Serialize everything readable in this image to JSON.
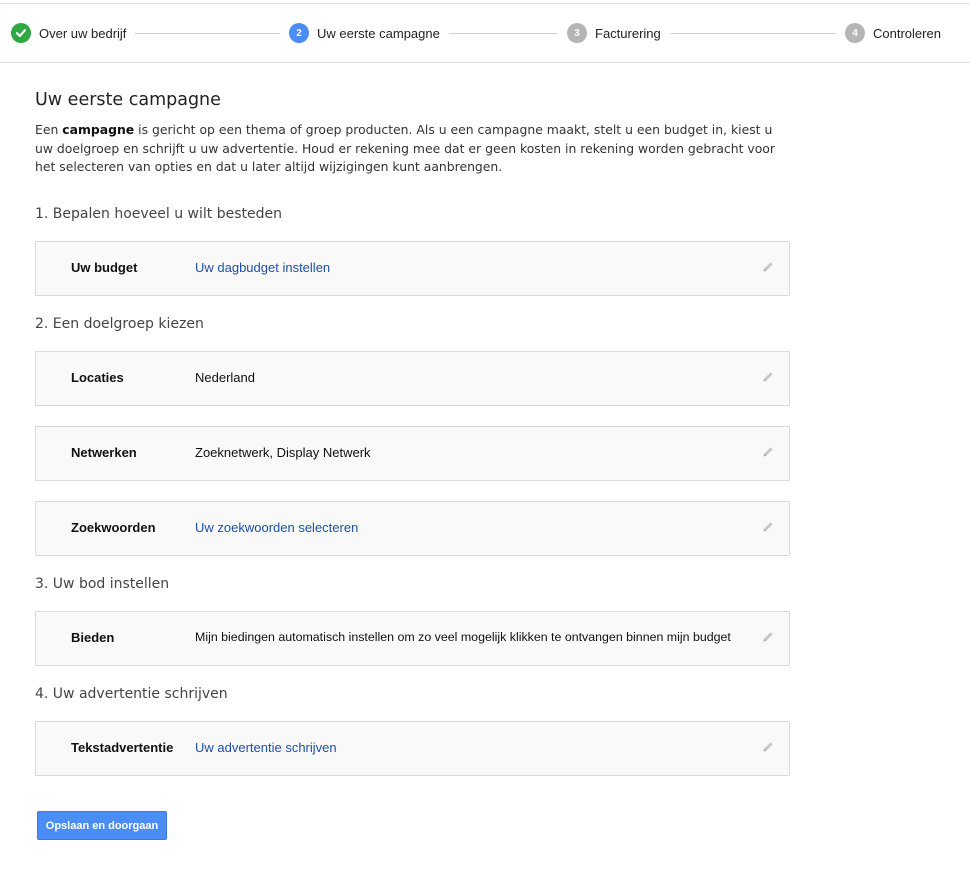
{
  "stepper": {
    "steps": [
      {
        "number": "",
        "label": "Over uw bedrijf",
        "state": "done"
      },
      {
        "number": "2",
        "label": "Uw eerste campagne",
        "state": "active"
      },
      {
        "number": "3",
        "label": "Facturering",
        "state": "pending"
      },
      {
        "number": "4",
        "label": "Controleren",
        "state": "pending"
      }
    ]
  },
  "page": {
    "title": "Uw eerste campagne",
    "intro_prefix": "Een ",
    "intro_bold": "campagne",
    "intro_rest": " is gericht op een thema of groep producten. Als u een campagne maakt, stelt u een budget in, kiest u uw doelgroep en schrijft u uw advertentie. Houd er rekening mee dat er geen kosten in rekening worden gebracht voor het selecteren van opties en dat u later altijd wijzigingen kunt aanbrengen."
  },
  "sections": [
    {
      "heading": "1. Bepalen hoeveel u wilt besteden"
    },
    {
      "heading": "2. Een doelgroep kiezen"
    },
    {
      "heading": "3. Uw bod instellen"
    },
    {
      "heading": "4. Uw advertentie schrijven"
    }
  ],
  "cards": {
    "budget": {
      "label": "Uw budget",
      "value": "Uw dagbudget instellen"
    },
    "locations": {
      "label": "Locaties",
      "value": "Nederland"
    },
    "networks": {
      "label": "Netwerken",
      "value": "Zoeknetwerk, Display Netwerk"
    },
    "keywords": {
      "label": "Zoekwoorden",
      "value": "Uw zoekwoorden selecteren"
    },
    "bidding": {
      "label": "Bieden",
      "value": "Mijn biedingen automatisch instellen om zo veel mogelijk klikken te ontvangen binnen mijn budget"
    },
    "text_ad": {
      "label": "Tekstadvertentie",
      "value": "Uw advertentie schrijven"
    }
  },
  "actions": {
    "save_label": "Opslaan en doorgaan"
  },
  "colors": {
    "accent": "#4a8df6",
    "done": "#2fa743",
    "pending": "#b5b5b5",
    "link": "#1d4fa8"
  },
  "icons": {
    "done_step": "checkmark-icon",
    "edit": "pencil-icon"
  }
}
